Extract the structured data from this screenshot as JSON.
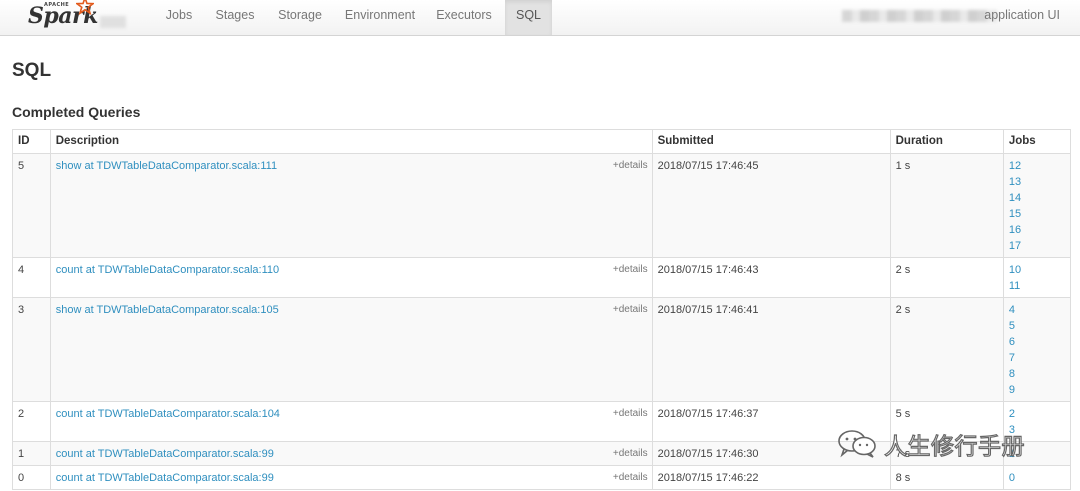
{
  "nav": {
    "brand_small": "APACHE",
    "brand": "Spark",
    "tabs": [
      {
        "label": "Jobs",
        "active": false
      },
      {
        "label": "Stages",
        "active": false
      },
      {
        "label": "Storage",
        "active": false
      },
      {
        "label": "Environment",
        "active": false
      },
      {
        "label": "Executors",
        "active": false
      },
      {
        "label": "SQL",
        "active": true
      }
    ],
    "app_name": "application UI"
  },
  "page_title": "SQL",
  "section_title": "Completed Queries",
  "table": {
    "headers": [
      "ID",
      "Description",
      "Submitted",
      "Duration",
      "Jobs"
    ],
    "details_label": "+details",
    "rows": [
      {
        "id": "5",
        "description": "show at TDWTableDataComparator.scala:111",
        "submitted": "2018/07/15 17:46:45",
        "duration": "1 s",
        "jobs": [
          "12",
          "13",
          "14",
          "15",
          "16",
          "17"
        ]
      },
      {
        "id": "4",
        "description": "count at TDWTableDataComparator.scala:110",
        "submitted": "2018/07/15 17:46:43",
        "duration": "2 s",
        "jobs": [
          "10",
          "11"
        ]
      },
      {
        "id": "3",
        "description": "show at TDWTableDataComparator.scala:105",
        "submitted": "2018/07/15 17:46:41",
        "duration": "2 s",
        "jobs": [
          "4",
          "5",
          "6",
          "7",
          "8",
          "9"
        ]
      },
      {
        "id": "2",
        "description": "count at TDWTableDataComparator.scala:104",
        "submitted": "2018/07/15 17:46:37",
        "duration": "5 s",
        "jobs": [
          "2",
          "3"
        ]
      },
      {
        "id": "1",
        "description": "count at TDWTableDataComparator.scala:99",
        "submitted": "2018/07/15 17:46:30",
        "duration": "7 s",
        "jobs": [
          "1"
        ]
      },
      {
        "id": "0",
        "description": "count at TDWTableDataComparator.scala:99",
        "submitted": "2018/07/15 17:46:22",
        "duration": "8 s",
        "jobs": [
          "0"
        ]
      }
    ]
  },
  "watermark": {
    "text": "人生修行手册",
    "icon": "wechat-icon"
  },
  "colors": {
    "link": "#2f8fbf",
    "active_tab": "#e2e2e2",
    "spark_star": "#e25a1c"
  }
}
